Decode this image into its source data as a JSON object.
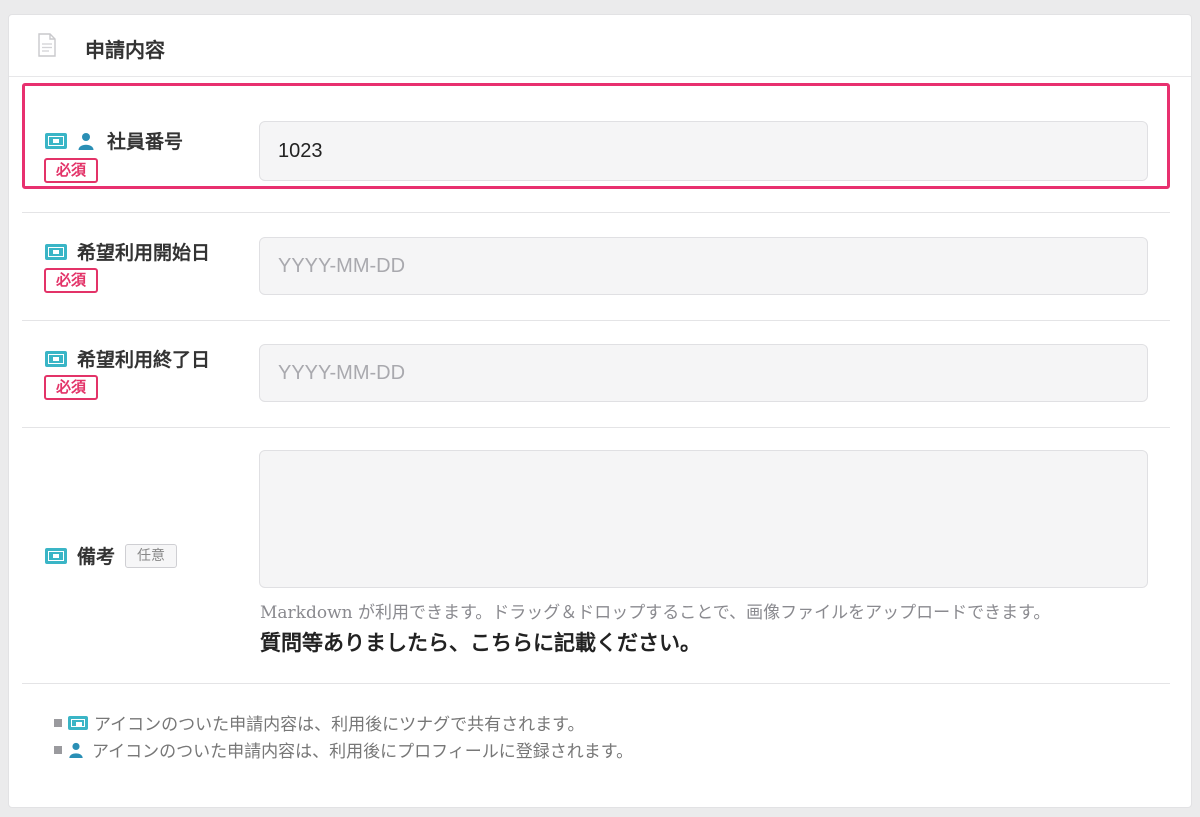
{
  "panel": {
    "title": "申請内容",
    "header_icon": "document-icon"
  },
  "fields": {
    "employee_no": {
      "label": "社員番号",
      "required_badge": "必須",
      "value": "1023",
      "icons": [
        "share-icon",
        "person-icon"
      ],
      "highlighted": true,
      "highlight_color": "#e8306f"
    },
    "start_date": {
      "label": "希望利用開始日",
      "required_badge": "必須",
      "placeholder": "YYYY-MM-DD",
      "icons": [
        "share-icon"
      ]
    },
    "end_date": {
      "label": "希望利用終了日",
      "required_badge": "必須",
      "placeholder": "YYYY-MM-DD",
      "icons": [
        "share-icon"
      ]
    },
    "remarks": {
      "label": "備考",
      "optional_badge": "任意",
      "icons": [
        "share-icon"
      ],
      "help_text": "Markdown が利用できます。ドラッグ＆ドロップすることで、画像ファイルをアップロードできます。",
      "note": "質問等ありましたら、こちらに記載ください。"
    }
  },
  "footnotes": [
    {
      "icon": "share-icon",
      "text": "アイコンのついた申請内容は、利用後にツナグで共有されます。"
    },
    {
      "icon": "person-icon",
      "text": "アイコンのついた申請内容は、利用後にプロフィールに登録されます。"
    }
  ],
  "colors": {
    "accent_teal": "#3ab5c6",
    "required_red": "#e33368",
    "highlight_border": "#e8306f",
    "person_icon_blue": "#2a8fb5"
  }
}
